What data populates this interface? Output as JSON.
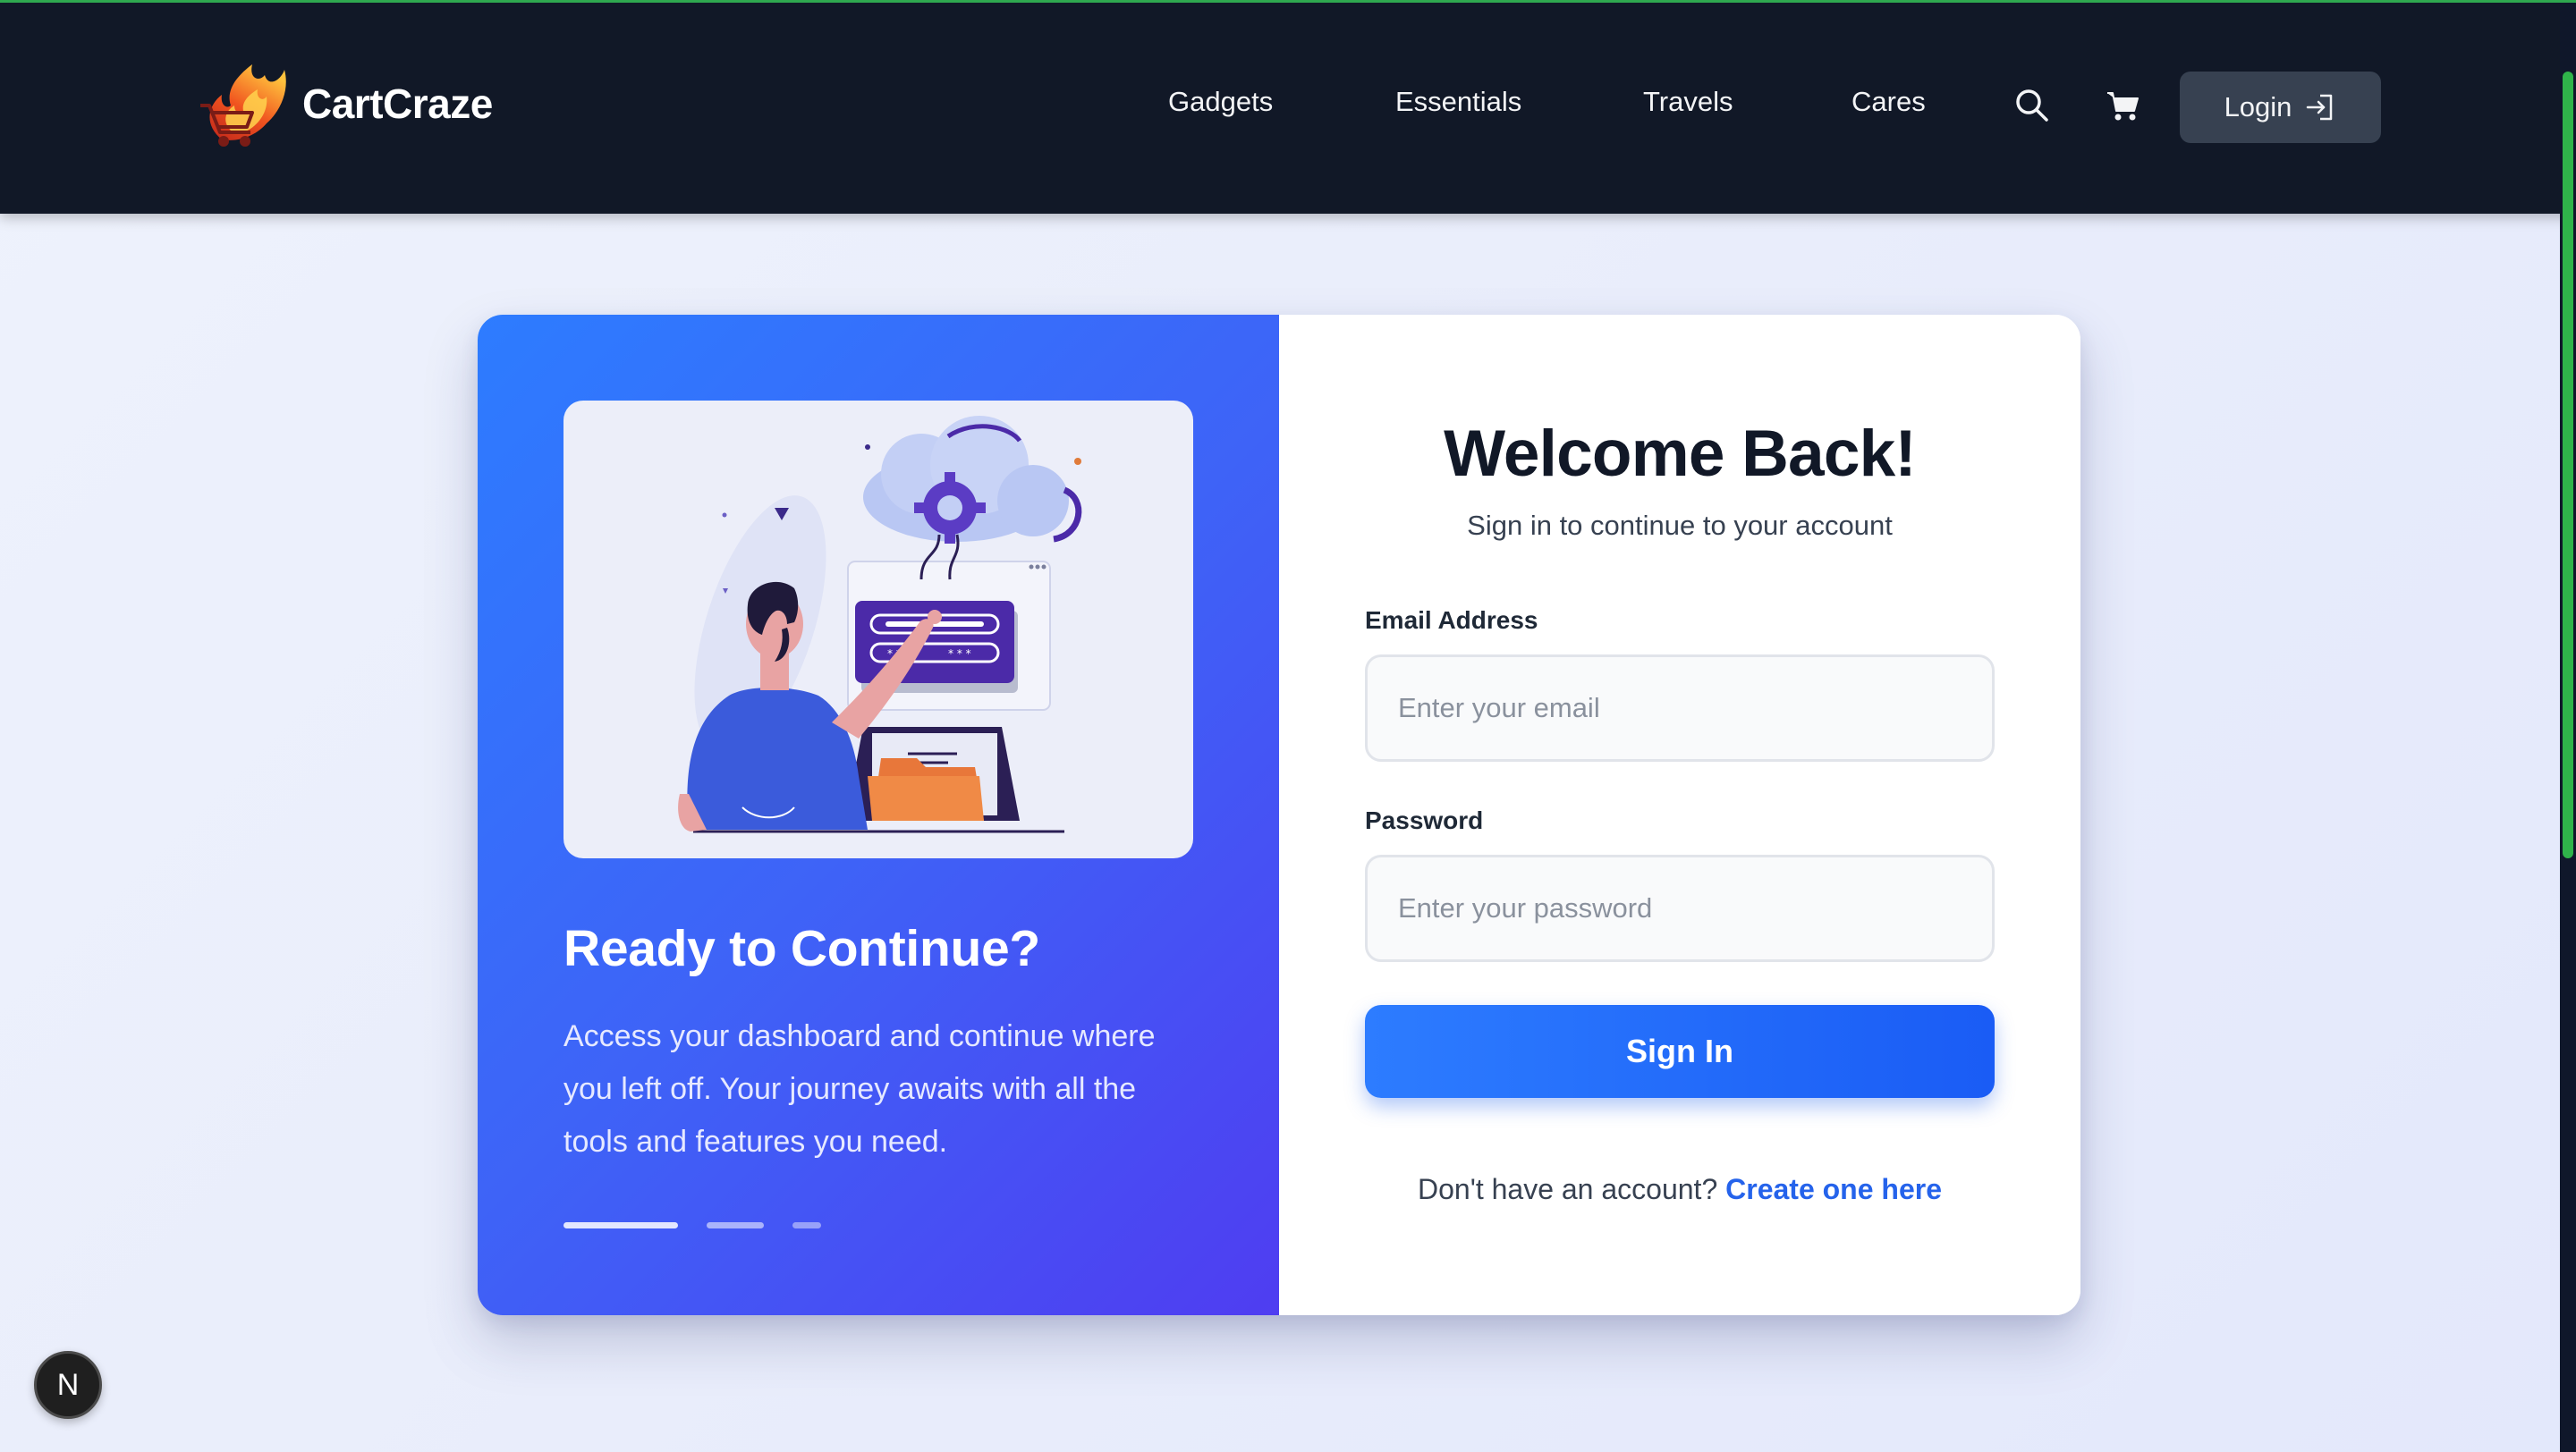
{
  "header": {
    "brand": "CartCraze",
    "nav": [
      "Gadgets",
      "Essentials",
      "Travels",
      "Cares"
    ],
    "login_label": "Login",
    "icons": [
      "search-icon",
      "cart-icon",
      "login-arrow-icon"
    ]
  },
  "hero": {
    "title": "Ready to Continue?",
    "description": "Access your dashboard and continue where you left off. Your journey awaits with all the tools and features you need.",
    "slide_count": 3,
    "active_slide": 1
  },
  "form": {
    "title": "Welcome Back!",
    "subtitle": "Sign in to continue to your account",
    "email_label": "Email Address",
    "email_placeholder": "Enter your email",
    "password_label": "Password",
    "password_placeholder": "Enter your password",
    "submit_label": "Sign In",
    "signup_prompt": "Don't have an account?",
    "signup_link": "Create one here"
  },
  "dev_badge": "N",
  "colors": {
    "nav_bg": "#111827",
    "accent": "#2563eb",
    "hero_gradient_start": "#2d7cff",
    "hero_gradient_end": "#4f3df1"
  }
}
